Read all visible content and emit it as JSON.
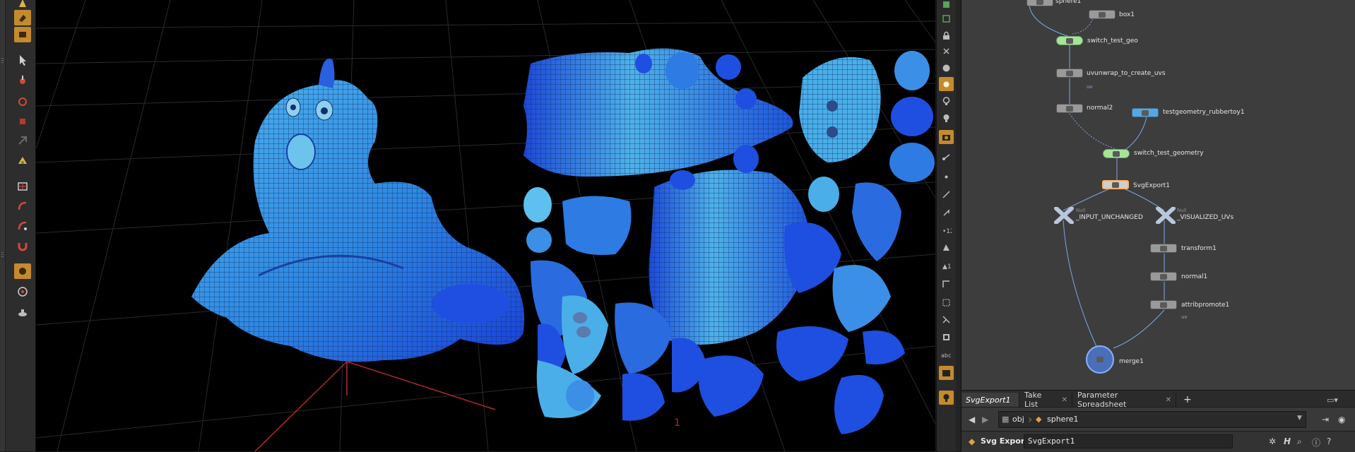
{
  "network": {
    "nodes": {
      "sphere1": "sphere1",
      "box1": "box1",
      "switch_test_geo": "switch_test_geo",
      "uvunwrap": "uvunwrap_to_create_uvs",
      "normal2": "normal2",
      "rubbertoy": "testgeometry_rubbertoy1",
      "switch_test_geometry": "switch_test_geometry",
      "svgexport": "SvgExport1",
      "input_unchanged": "_INPUT_UNCHANGED",
      "visualized_uvs": "_VISUALIZED_UVs",
      "transform1": "transform1",
      "normal1": "normal1",
      "attribpromote1": "attribpromote1",
      "merge1": "merge1"
    },
    "sublabels": {
      "uv1": "uv",
      "uv2": "uv",
      "null1": "Null",
      "null2": "Null"
    }
  },
  "tabs": [
    {
      "label": "SvgExport1",
      "active": true,
      "closable": false
    },
    {
      "label": "Take List",
      "active": false,
      "closable": true
    },
    {
      "label": "Parameter Spreadsheet",
      "active": false,
      "closable": true
    }
  ],
  "tab_add": "+",
  "path": {
    "segments": [
      "obj",
      "sphere1"
    ]
  },
  "param": {
    "type_label": "Svg Export",
    "node_name": "SvgExport1"
  },
  "colors": {
    "accent": "#c48a2c",
    "selected_node": "#ffb26a",
    "uv_blue": "#2f7fe6"
  },
  "icons": {
    "back": "left-arrow-icon",
    "forward": "right-arrow-icon",
    "pin": "pin-icon",
    "gear": "gear-icon",
    "search": "search-icon",
    "info": "info-icon",
    "help": "help-icon"
  }
}
